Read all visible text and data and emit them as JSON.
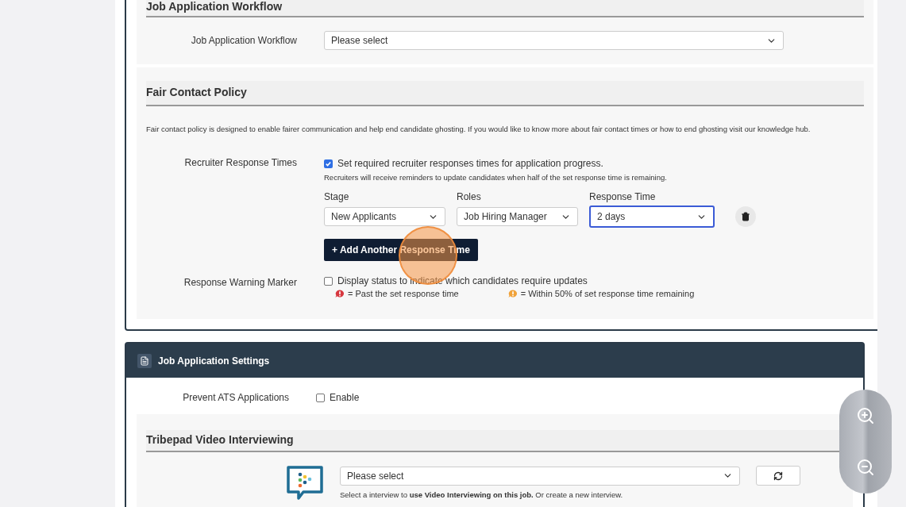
{
  "workflow": {
    "heading": "Job Application Workflow",
    "label": "Job Application Workflow",
    "value": "Please select"
  },
  "fair_contact": {
    "heading": "Fair Contact Policy",
    "description": "Fair contact policy is designed to enable fairer communication and help end candidate ghosting. If you would like to know more about fair contact times or how to end ghosting visit our knowledge hub.",
    "response_times": {
      "label": "Recruiter Response Times",
      "checkbox": {
        "label": "Set required recruiter responses times for application progress.",
        "checked": true
      },
      "note": "Recruiters will receive reminders to update candidates when half of the set response time is remaining.",
      "columns": [
        "Stage",
        "Roles",
        "Response Time"
      ],
      "rows": [
        {
          "stage": "New Applicants",
          "role": "Job Hiring Manager",
          "response_time": "2 days",
          "focused": true
        }
      ],
      "add_button": "+ Add Another Response Time"
    },
    "warning_marker": {
      "label": "Response Warning Marker",
      "checkbox": {
        "label": "Display status to indicate which candidates require updates",
        "checked": false
      },
      "legend": [
        {
          "text": "= Past the set response time",
          "color": "#d7373f"
        },
        {
          "text": "= Within 50% of set response time remaining",
          "color": "#f0a23a"
        }
      ]
    }
  },
  "job_application_settings": {
    "title": "Job Application Settings",
    "prevent_ats": {
      "label": "Prevent ATS Applications",
      "checkbox": {
        "label": "Enable",
        "checked": false
      }
    },
    "video": {
      "heading": "Tribepad Video Interviewing",
      "value": "Please select",
      "help": "Select a interview to **use Video Interviewing on this job.** Or create a new interview."
    }
  }
}
